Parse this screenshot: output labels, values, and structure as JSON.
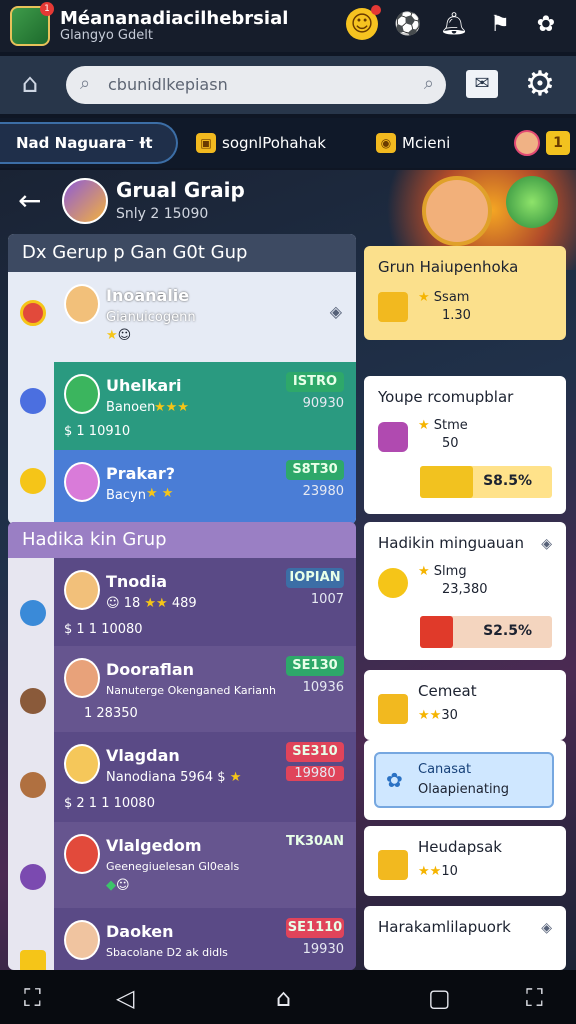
{
  "app": {
    "title": "Méananadiacilhebrsial",
    "subtitle": "Glangyo Gdelt",
    "icon_badge": "1"
  },
  "top_icons": [
    "smiley-icon",
    "soccer-icon",
    "bell-icon",
    "flag-icon",
    "gear-icon"
  ],
  "search": {
    "placeholder": "cbunidlkepiasn"
  },
  "tabs": [
    {
      "label": "Nad Naguara⁻ Ɨt"
    },
    {
      "label": "sognlPohahak"
    },
    {
      "label": "Mcieni"
    },
    {
      "label": "1"
    }
  ],
  "group": {
    "title": "Grual Graip",
    "subtitle": "Snly 2 15090"
  },
  "section1": {
    "title": "Dx Gerup p Gan G0t Gup",
    "rows": [
      {
        "name": "Inoanalie",
        "sub": "Gianuicogenn",
        "meta": "",
        "tag": "",
        "tag2": ""
      },
      {
        "name": "Uhelkari",
        "sub": "Banoen",
        "meta": "$ 1 10910",
        "tag": "ISTRO",
        "tag2": "90930"
      },
      {
        "name": "Prakar?",
        "sub": "Bacyn",
        "meta": "",
        "tag": "S8T30",
        "tag2": "23980"
      }
    ]
  },
  "section2": {
    "title": "Hadika kin Grup",
    "rows": [
      {
        "name": "Tnodia",
        "sub": "18",
        "sub2": "489",
        "meta": "$ 1 1 10080",
        "tag": "IOPIAN",
        "tag2": "1007"
      },
      {
        "name": "Dooraflan",
        "sub": "Nanuterge Okenganed Karianh",
        "meta": "1 28350",
        "tag": "SE130",
        "tag2": "10936"
      },
      {
        "name": "Vlagdan",
        "sub": "Nanodiana",
        "sub2": "5964 $",
        "meta": "$ 2 1 1 10080",
        "tag": "SE310",
        "tag2": "19980"
      },
      {
        "name": "Vlalgedom",
        "sub": "Geenegiuelesan Gl0eals",
        "meta": "",
        "tag": "TK30AN",
        "tag2": ""
      },
      {
        "name": "Daoken",
        "sub": "Sbacolane D2 ak didls",
        "meta": "",
        "tag": "SE1110",
        "tag2": "19930"
      }
    ]
  },
  "right": {
    "card1": {
      "title": "Grun Haiupenhoka",
      "stat1": "Ssam",
      "stat2": "1.30"
    },
    "card2": {
      "title": "Youpe rcomupblar",
      "stat1": "Stme",
      "stat2": "50",
      "bar": "S8.5%",
      "bar_pct": 0.4
    },
    "card3": {
      "title": "Hadikin minguauan",
      "stat1": "Slmg",
      "stat2": "23,380",
      "bar": "S2.5%",
      "bar_pct": 0.25
    },
    "card4": {
      "title": "Cemeat",
      "stat2": "30"
    },
    "card5": {
      "t1": "Canasat",
      "t2": "Olaapienating"
    },
    "card6": {
      "title": "Heudapsak",
      "stat2": "10"
    },
    "card7": {
      "title": "Harakamlilapuork"
    }
  },
  "colors": {
    "accent": "#3c6ea6",
    "gold": "#f5c518",
    "green": "#2ea86a"
  }
}
